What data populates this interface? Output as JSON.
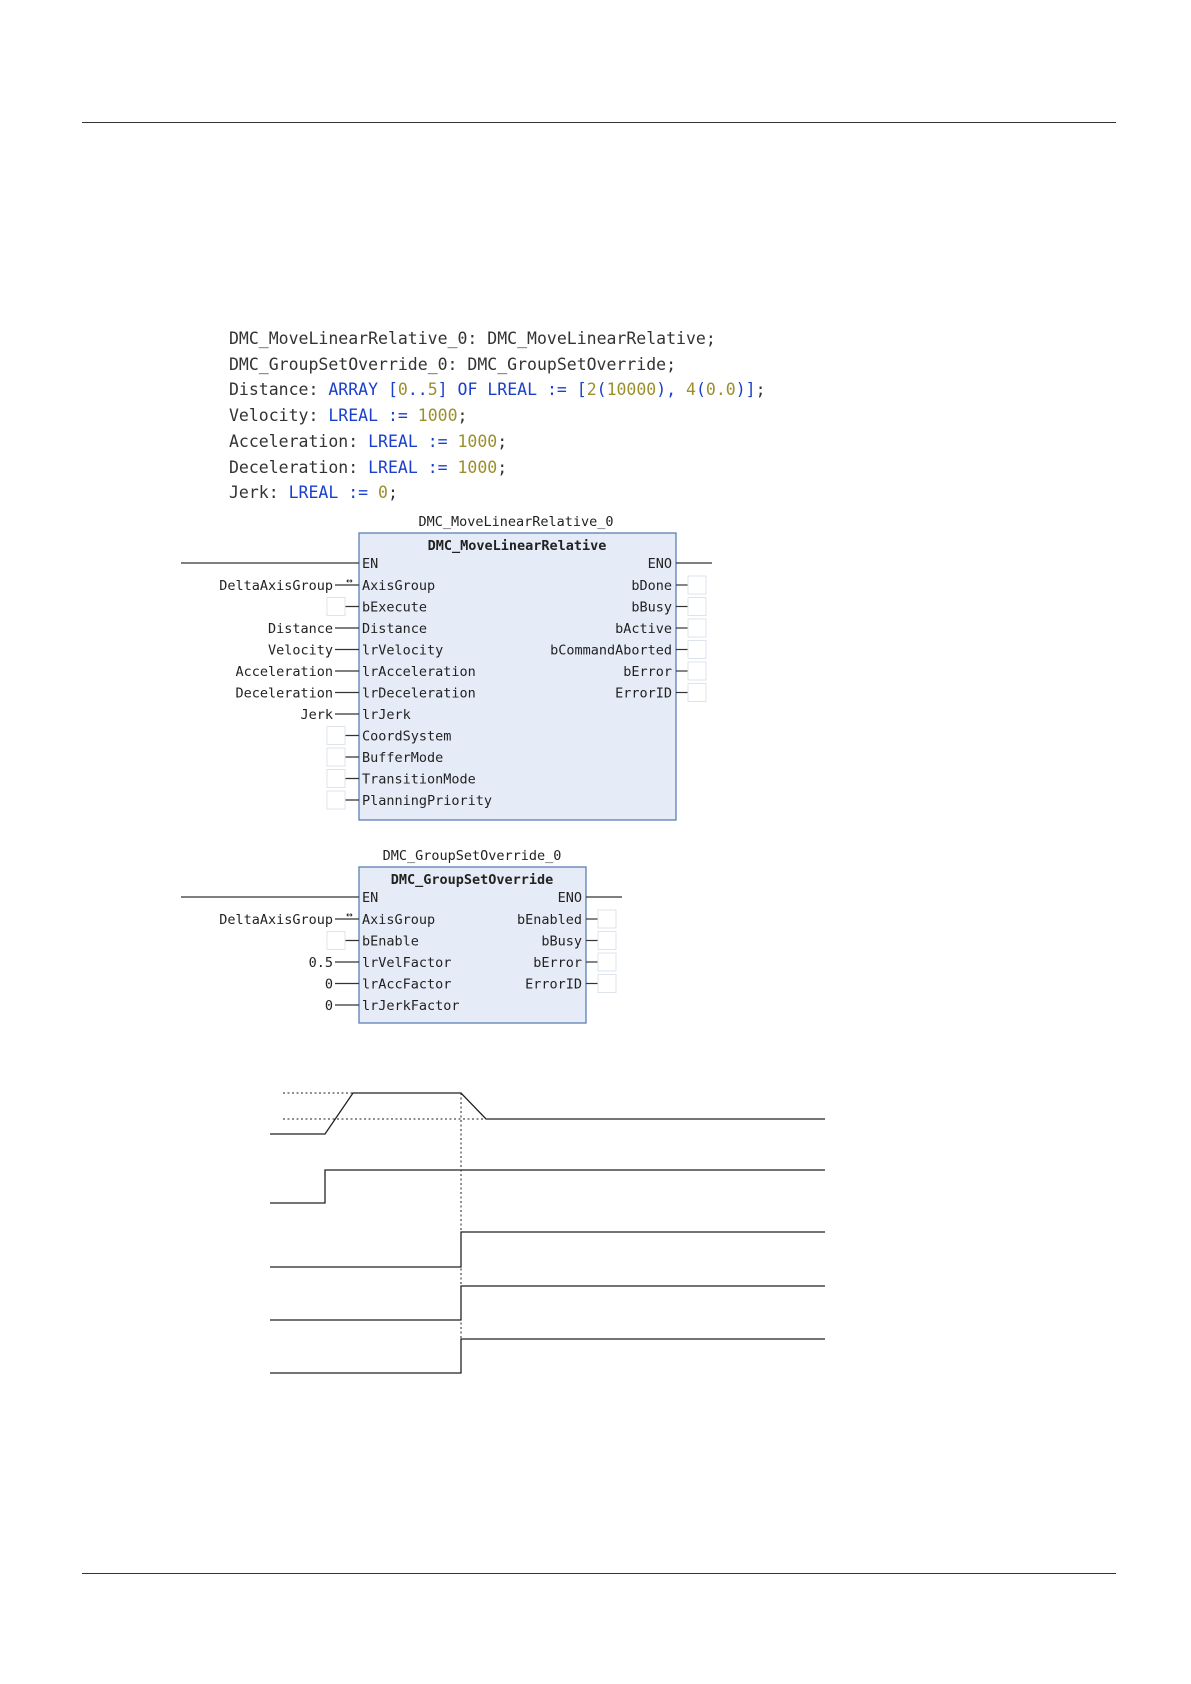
{
  "code": {
    "line1": {
      "name": "DMC_MoveLinearRelative_0:",
      "type": "DMC_MoveLinearRelative;"
    },
    "line2": {
      "name": "DMC_GroupSetOverride_0:",
      "type": "DMC_GroupSetOverride;"
    },
    "line3": {
      "name": "Distance:",
      "kw1": "ARRAY",
      "b1": "[",
      "n1": "0",
      "dots": "..",
      "n2": "5",
      "b2": "]",
      "kw2": "OF",
      "kw3": "LREAL",
      "assign": ":=",
      "b3": "[",
      "n3": "2",
      "p1": "(",
      "n4": "10000",
      "p2": "),",
      "n5": "4",
      "p3": "(",
      "n6": "0.0",
      "p4": ")]",
      "end": ";"
    },
    "line4": {
      "name": "Velocity:",
      "kw": "LREAL",
      "assign": ":=",
      "val": "1000",
      "end": ";"
    },
    "line5": {
      "name": "Acceleration:",
      "kw": "LREAL",
      "assign": ":=",
      "val": "1000",
      "end": ";"
    },
    "line6": {
      "name": "Deceleration:",
      "kw": "LREAL",
      "assign": ":=",
      "val": "1000",
      "end": ";"
    },
    "line7": {
      "name": "Jerk:",
      "kw": "LREAL",
      "assign": ":=",
      "val": "0",
      "end": ";"
    }
  },
  "fb1": {
    "instance": "DMC_MoveLinearRelative_0",
    "type": "DMC_MoveLinearRelative",
    "en": "EN",
    "eno": "ENO",
    "inputs": [
      "AxisGroup",
      "bExecute",
      "Distance",
      "lrVelocity",
      "lrAcceleration",
      "lrDeceleration",
      "lrJerk",
      "CoordSystem",
      "BufferMode",
      "TransitionMode",
      "PlanningPriority"
    ],
    "input_values": [
      "DeltaAxisGroup",
      "",
      "Distance",
      "Velocity",
      "Acceleration",
      "Deceleration",
      "Jerk",
      "",
      "",
      "",
      ""
    ],
    "outputs": [
      "bDone",
      "bBusy",
      "bActive",
      "bCommandAborted",
      "bError",
      "ErrorID"
    ]
  },
  "fb2": {
    "instance": "DMC_GroupSetOverride_0",
    "type": "DMC_GroupSetOverride",
    "en": "EN",
    "eno": "ENO",
    "inputs": [
      "AxisGroup",
      "bEnable",
      "lrVelFactor",
      "lrAccFactor",
      "lrJerkFactor"
    ],
    "input_values": [
      "DeltaAxisGroup",
      "",
      "0.5",
      "0",
      "0"
    ],
    "outputs": [
      "bEnabled",
      "bBusy",
      "bError",
      "ErrorID"
    ]
  },
  "inout_marker": "↔"
}
